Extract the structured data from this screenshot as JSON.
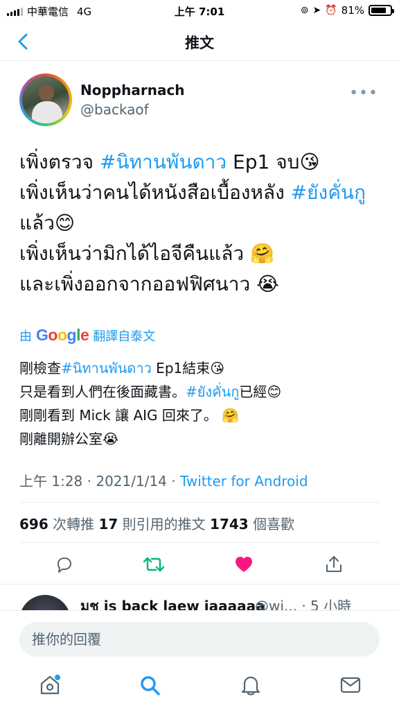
{
  "status_bar": {
    "carrier": "中華電信",
    "network": "4G",
    "time": "上午 7:01",
    "battery": "81%",
    "battery_level": 0.81
  },
  "navbar": {
    "title": "推文"
  },
  "tweet": {
    "author_name": "Noppharnach",
    "author_handle": "@backaof",
    "body": {
      "l1_a": "เพิ่งตรวจ ",
      "l1_tag": "#นิทานพันดาว",
      "l1_b": " Ep1 จบ😘",
      "l2_a": "เพิ่งเห็นว่าคนได้หนังสือเบื้องหลัง ",
      "l2_tag": "#ยังคั่นกู",
      "l2_b": "  แล้ว😊",
      "l3": "เพิ่งเห็นว่ามิกได้ไอจีคืนแล้ว 🤗",
      "l4": "และเพิ่งออกจากออฟฟิศนาว 😭"
    },
    "translate": {
      "prefix": "由",
      "google": [
        "G",
        "o",
        "o",
        "g",
        "l",
        "e"
      ],
      "suffix": "翻譯自泰文"
    },
    "translated": {
      "l1_a": "剛檢查",
      "l1_tag": "#นิทานพันดาว",
      "l1_b": " Ep1結束😘",
      "l2_a": "只是看到人們在後面藏書。",
      "l2_tag": "#ยังคั่นกู",
      "l2_b": "已經😊",
      "l3": "剛剛看到 Mick 讓 AIG 回來了。 🤗",
      "l4": "剛離開辦公室😭"
    },
    "time": "上午 1:28 · 2021/1/14 · ",
    "source": "Twitter for Android",
    "stats": {
      "retweets": "696",
      "retweets_label": " 次轉推  ",
      "quotes": "17",
      "quotes_label": " 則引用的推文  ",
      "likes": "1743",
      "likes_label": " 個喜歡"
    },
    "liked": true,
    "like_color": "#f91880",
    "retweet_color": "#00ba7c"
  },
  "reply": {
    "name": "มช is back laew jaaaaaa",
    "meta": "@wi... · 5 小時"
  },
  "composer": {
    "placeholder": "推你的回覆"
  },
  "tabbar": {
    "items": [
      "home-icon",
      "search-icon",
      "notifications-icon",
      "messages-icon"
    ],
    "accent": "#1d9bf0"
  }
}
